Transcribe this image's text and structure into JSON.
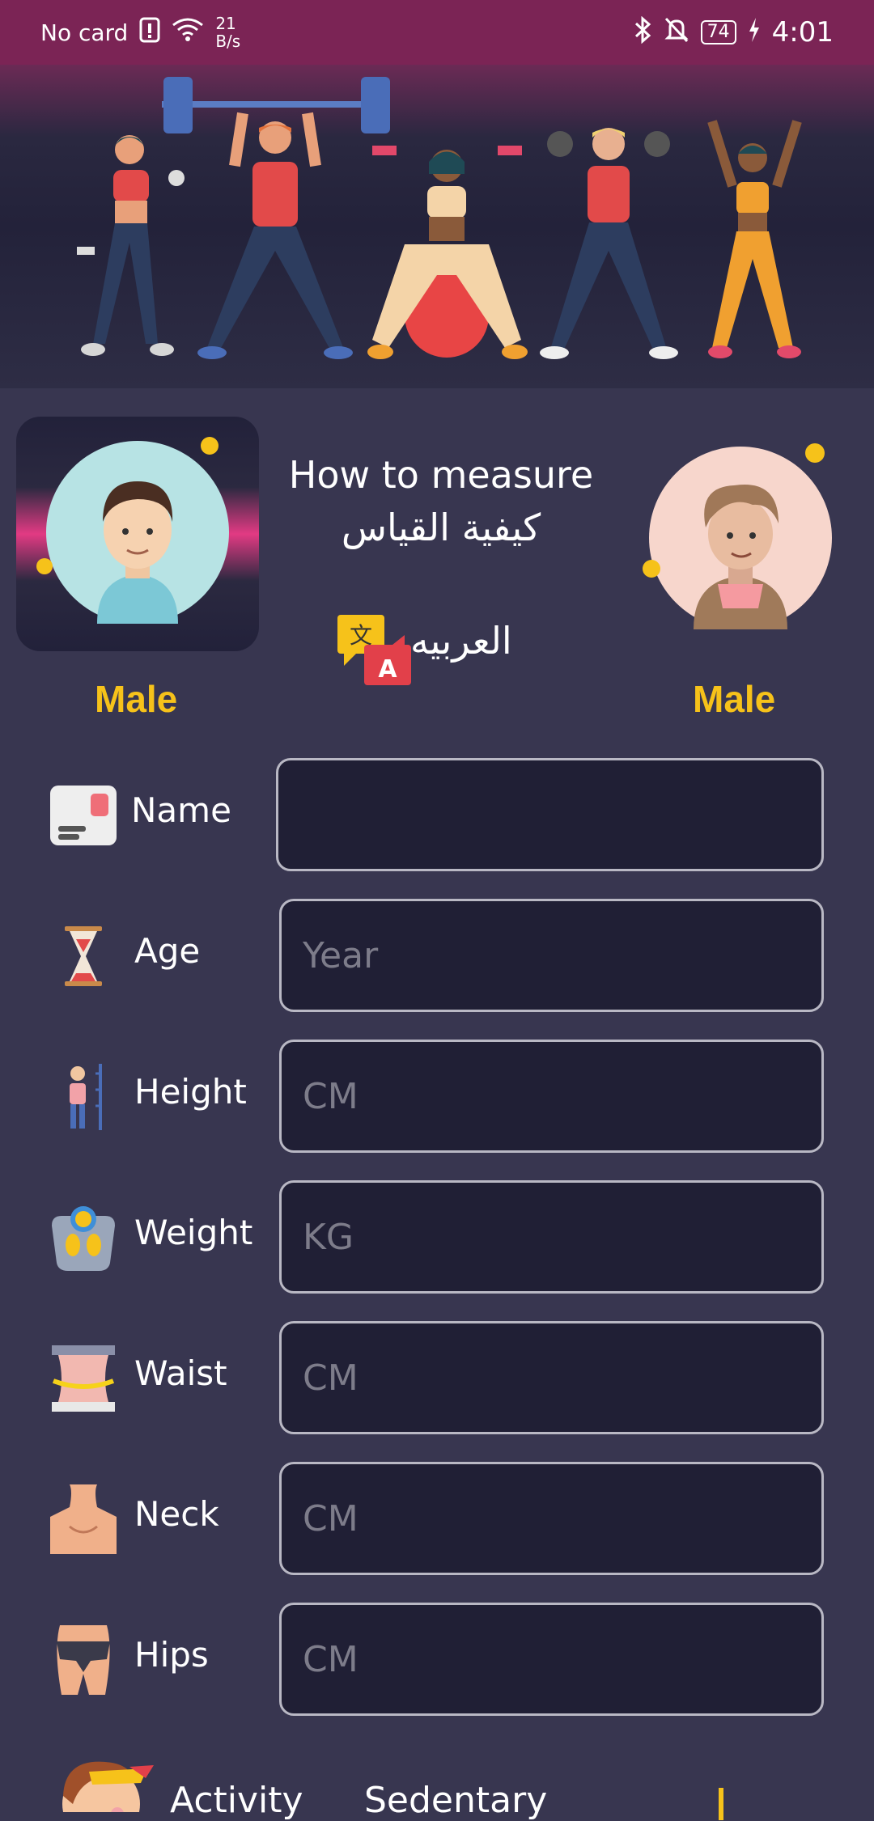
{
  "status_bar": {
    "carrier": "No card",
    "net_speed_value": "21",
    "net_speed_unit": "B/s",
    "battery": "74",
    "time": "4:01"
  },
  "header": {
    "how_to_measure_en": "How to measure",
    "how_to_measure_ar": "كيفية القياس",
    "language_label": "العربيه"
  },
  "gender": {
    "left_label": "Male",
    "right_label": "Male"
  },
  "form": {
    "name": {
      "label": "Name",
      "value": "",
      "placeholder": ""
    },
    "age": {
      "label": "Age",
      "placeholder": "Year"
    },
    "height": {
      "label": "Height",
      "placeholder": "CM"
    },
    "weight": {
      "label": "Weight",
      "placeholder": "KG"
    },
    "waist": {
      "label": "Waist",
      "placeholder": "CM"
    },
    "neck": {
      "label": "Neck",
      "placeholder": "CM"
    },
    "hips": {
      "label": "Hips",
      "placeholder": "CM"
    },
    "activity": {
      "label": "Activity",
      "value": "Sedentary"
    }
  },
  "colors": {
    "accent_yellow": "#f6c21a",
    "status_bar": "#7b2455",
    "background": "#383650",
    "field_bg": "#201f35"
  }
}
